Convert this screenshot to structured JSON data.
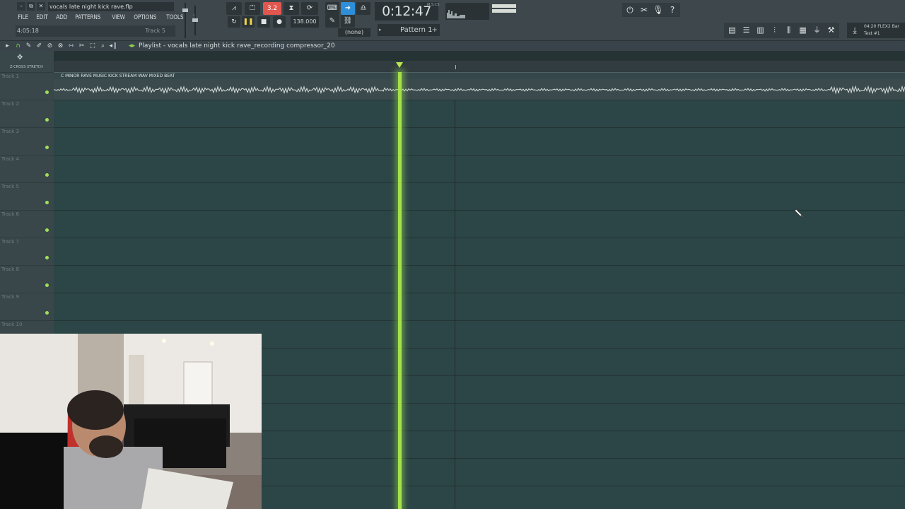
{
  "window": {
    "filename": "vocals late night kick rave.flp",
    "controls": [
      "–",
      "⧉",
      "✕"
    ]
  },
  "menu": [
    "FILE",
    "EDIT",
    "ADD",
    "PATTERNS",
    "VIEW",
    "OPTIONS",
    "TOOLS",
    "?"
  ],
  "hint": {
    "time": "4:05:18",
    "track": "Track 5"
  },
  "transport": {
    "tempo": "138.000",
    "clock": "0:12:47",
    "clock_unit": "M:S:CS",
    "pattern": "Pattern 1",
    "record_label": "3.2",
    "none_label": "(none)",
    "play_icon": "pause-icon",
    "stop_icon": "stop-icon",
    "record_icon": "record-icon"
  },
  "flex": {
    "line1": "04:20 FLEX2 Bar",
    "line2": "Test #1"
  },
  "playlist": {
    "title": "Playlist - vocals late night kick rave_recording compressor_20",
    "snap_label": "Z-CROSS  STRETCH"
  },
  "tracks": [
    "Track 1",
    "Track 2",
    "Track 3",
    "Track 4",
    "Track 5",
    "Track 6",
    "Track 7",
    "Track 8",
    "Track 9",
    "Track 10"
  ],
  "clip": {
    "name": "C MINOR RAVE MUSIC KICK STREAM WAV MIXED BEAT"
  },
  "colors": {
    "accent_green": "#a6e04a",
    "record_red": "#e1574f",
    "tempo_blue": "#2f8ed8",
    "grid_bg": "#2c4546"
  }
}
